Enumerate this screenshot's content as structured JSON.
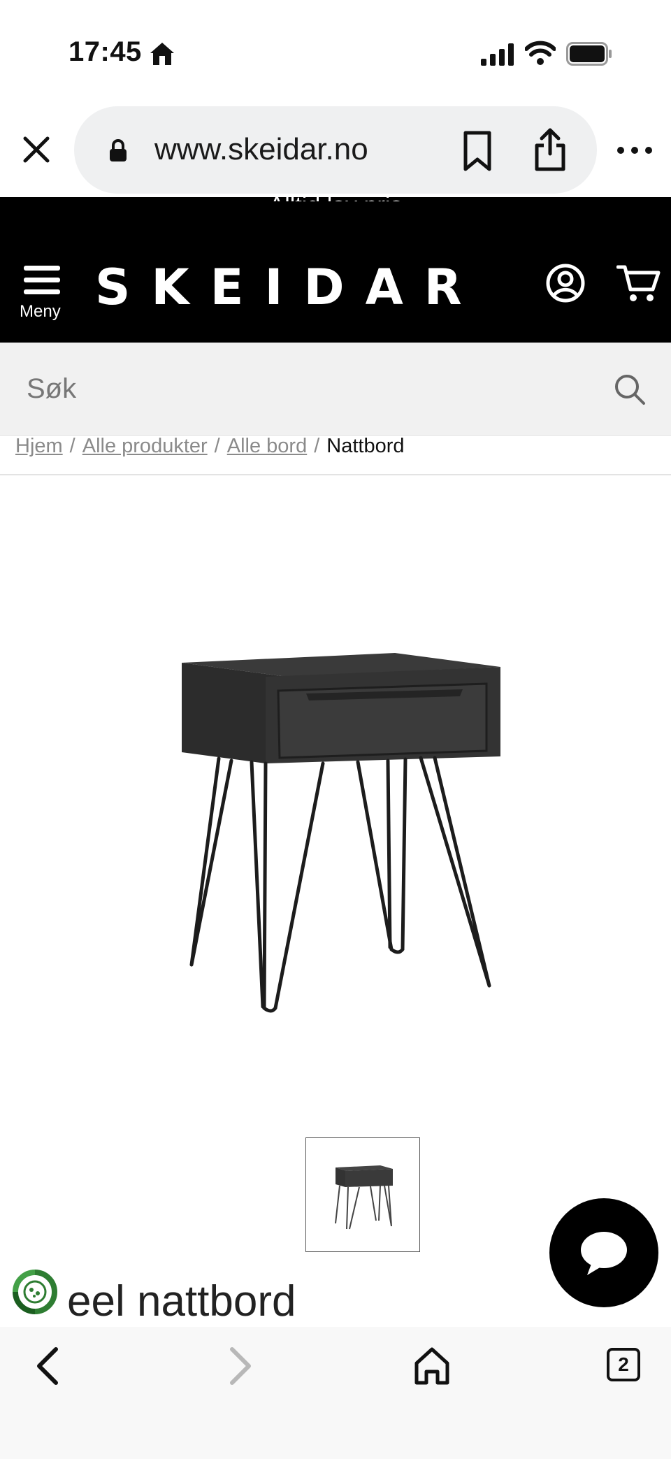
{
  "status_bar": {
    "time": "17:45"
  },
  "browser": {
    "url": "www.skeidar.no",
    "tab_count": "2"
  },
  "site": {
    "promo": "Alltid lav pris",
    "logo": "SKEIDAR",
    "menu_label": "Meny",
    "search_placeholder": "Søk"
  },
  "breadcrumb": {
    "items": [
      "Hjem",
      "Alle produkter",
      "Alle bord"
    ],
    "current": "Nattbord"
  },
  "product": {
    "title": "eel nattbord"
  },
  "colors": {
    "header_bg": "#000000",
    "search_bg": "#f1f1f1",
    "eco_green": "#2e7d32"
  }
}
